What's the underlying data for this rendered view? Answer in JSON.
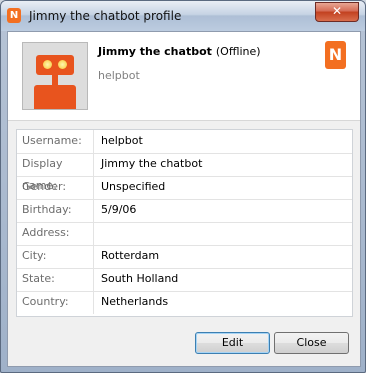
{
  "window": {
    "title": "Jimmy the chatbot profile",
    "app_icon_letter": "N",
    "close_glyph": "✕"
  },
  "profile": {
    "display_name": "Jimmy the chatbot",
    "status": "(Offline)",
    "username": "helpbot",
    "brand_letter": "N",
    "avatar": "robot-avatar"
  },
  "fields": [
    {
      "label": "Username:",
      "value": "helpbot"
    },
    {
      "label": "Display name:",
      "value": "Jimmy the chatbot"
    },
    {
      "label": "Gender:",
      "value": "Unspecified"
    },
    {
      "label": "Birthday:",
      "value": "5/9/06"
    },
    {
      "label": "Address:",
      "value": ""
    },
    {
      "label": "City:",
      "value": "Rotterdam"
    },
    {
      "label": "State:",
      "value": "South Holland"
    },
    {
      "label": "Country:",
      "value": "Netherlands"
    }
  ],
  "buttons": {
    "edit": "Edit",
    "close": "Close"
  },
  "colors": {
    "brand": "#f36f21",
    "robot": "#e8541e"
  }
}
